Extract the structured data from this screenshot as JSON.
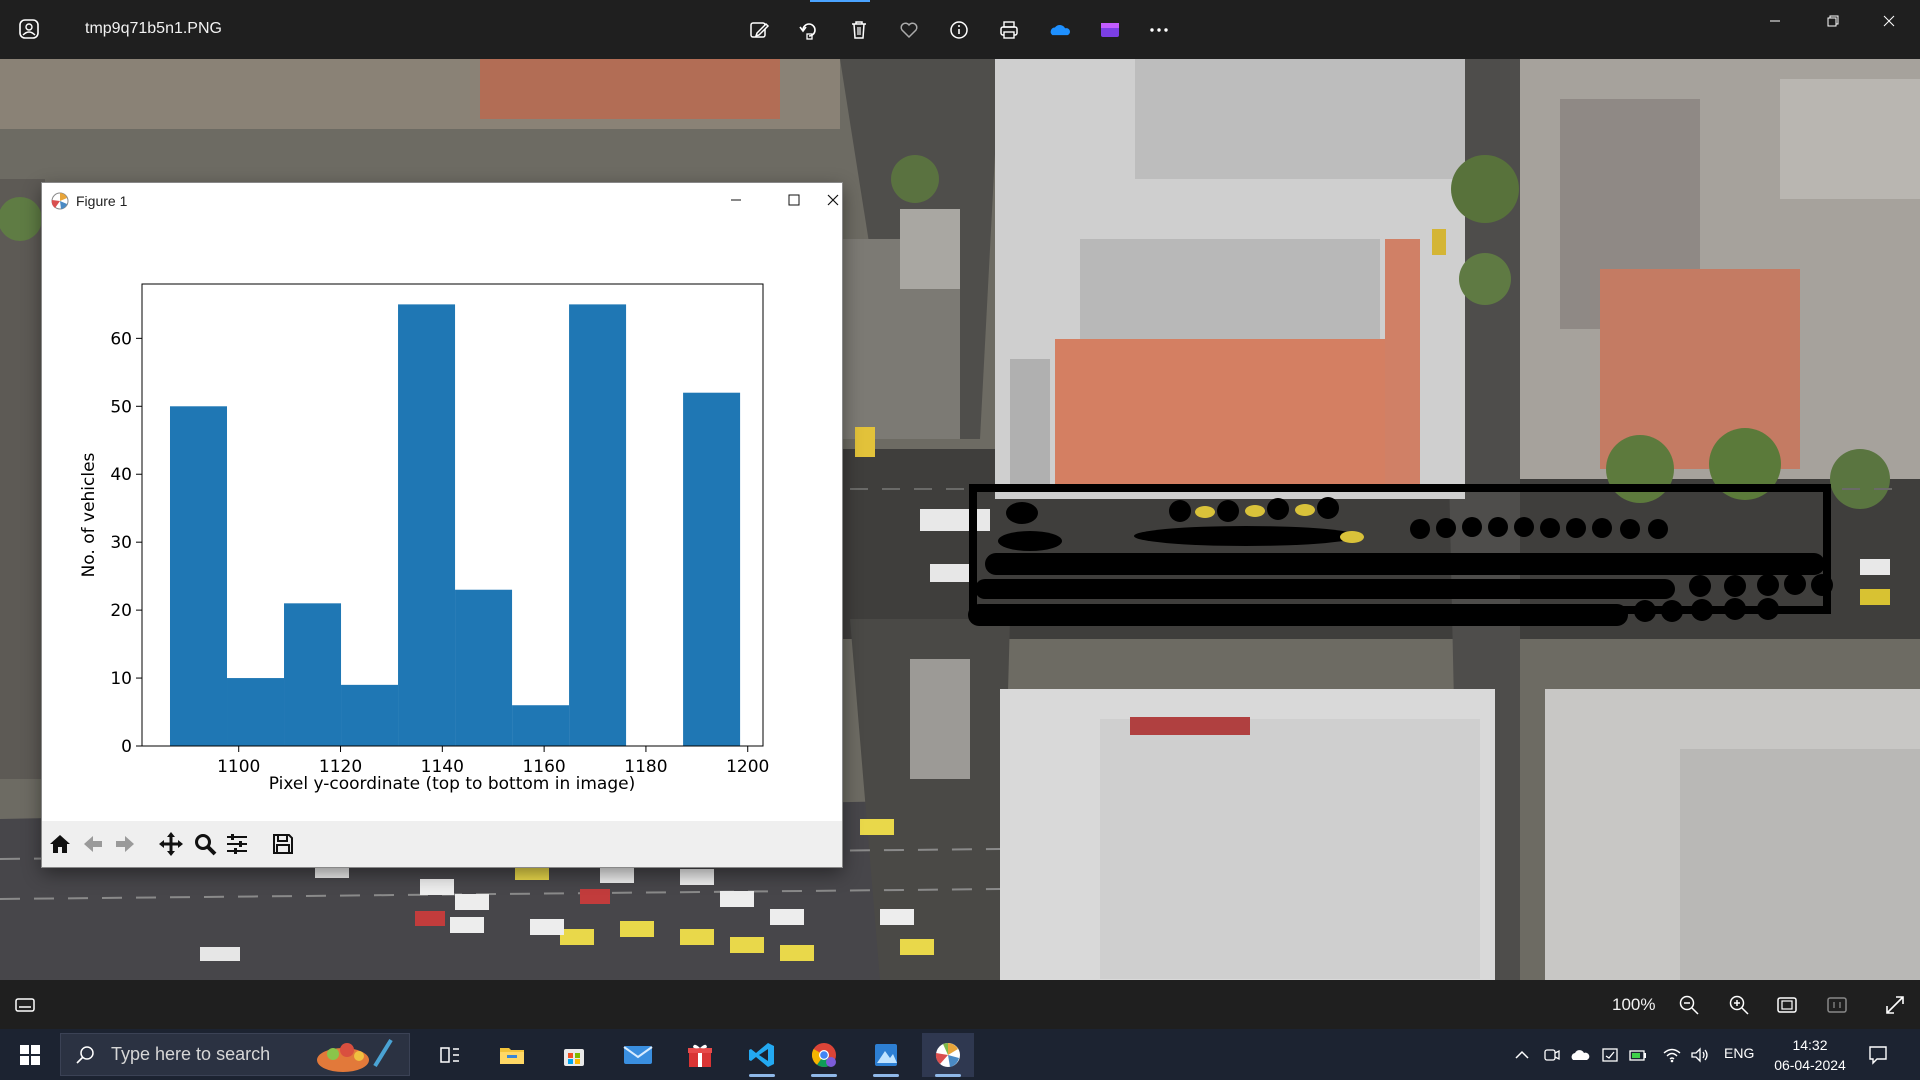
{
  "window": {
    "file_name": "tmp9q71b5n1.PNG",
    "controls": {
      "minimize": "—",
      "maximize": "□",
      "close": "✕"
    }
  },
  "toolbar_icons": [
    "edit-icon",
    "rotate-icon",
    "delete-icon",
    "favorite-icon",
    "info-icon",
    "print-icon",
    "onedrive-icon",
    "clipchamp-icon",
    "more-icon"
  ],
  "figure": {
    "title": "Figure 1",
    "toolbar": [
      "home-icon",
      "back-icon",
      "forward-icon",
      "pan-icon",
      "zoom-icon",
      "configure-icon",
      "save-icon"
    ]
  },
  "chart_data": {
    "type": "bar",
    "xlabel": "Pixel y-coordinate (top to bottom in image)",
    "ylabel": "No. of vehicles",
    "xlim": [
      1081,
      1203
    ],
    "ylim": [
      0,
      68
    ],
    "xticks": [
      1100,
      1120,
      1140,
      1160,
      1180,
      1200
    ],
    "yticks": [
      0,
      10,
      20,
      30,
      40,
      50,
      60
    ],
    "bin_width": 11.2,
    "bins": [
      1086.5,
      1097.7,
      1108.9,
      1120.1,
      1131.3,
      1142.5,
      1153.7,
      1164.9,
      1176.1,
      1187.3
    ],
    "values": [
      50,
      10,
      21,
      9,
      65,
      23,
      6,
      65,
      0,
      52
    ],
    "color": "#1f77b4",
    "grid": false
  },
  "bottom_bar": {
    "zoom_level": "100%"
  },
  "taskbar": {
    "search_placeholder": "Type here to search",
    "apps": [
      "task-view-icon",
      "file-explorer-icon",
      "store-icon",
      "mail-icon",
      "gift-icon",
      "vscode-icon",
      "chrome-icon",
      "image-app-icon",
      "photos-icon"
    ],
    "language": "ENG",
    "time": "14:32",
    "date": "06-04-2024"
  }
}
